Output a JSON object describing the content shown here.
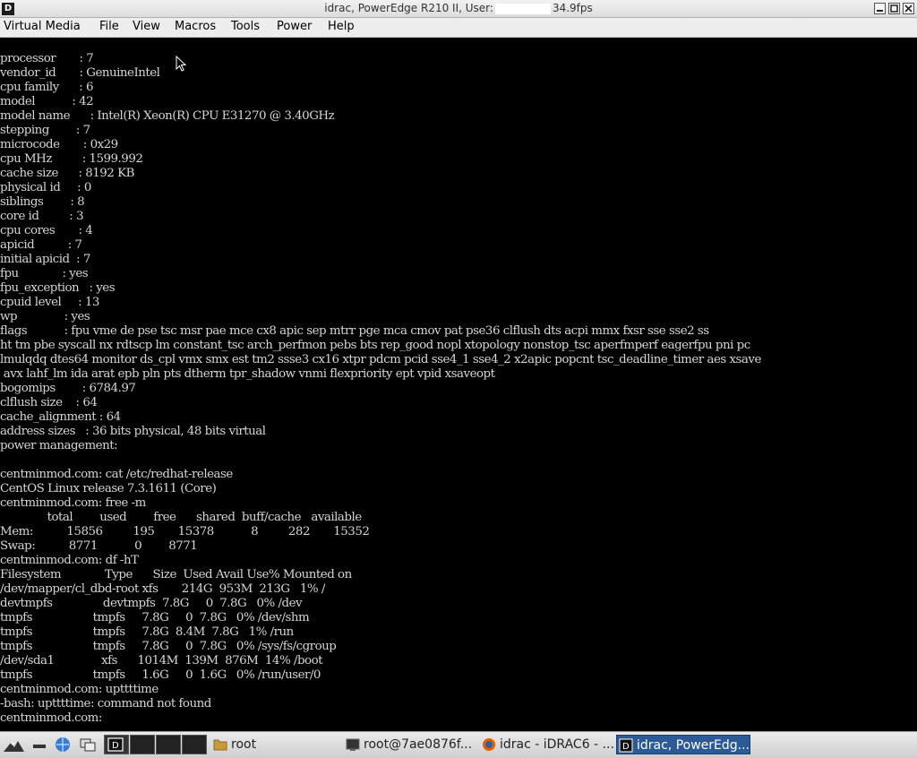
{
  "window": {
    "title_left": "idrac, PowerEdge R210 II, User:",
    "title_right": "34.9fps"
  },
  "menu": {
    "items": [
      "Virtual Media",
      "File",
      "View",
      "Macros",
      "Tools",
      "Power",
      "Help"
    ]
  },
  "console": {
    "lines": [
      "processor       : 7",
      "vendor_id       : GenuineIntel",
      "cpu family      : 6",
      "model           : 42",
      "model name      : Intel(R) Xeon(R) CPU E31270 @ 3.40GHz",
      "stepping        : 7",
      "microcode       : 0x29",
      "cpu MHz         : 1599.992",
      "cache size      : 8192 KB",
      "physical id     : 0",
      "siblings        : 8",
      "core id         : 3",
      "cpu cores       : 4",
      "apicid          : 7",
      "initial apicid  : 7",
      "fpu             : yes",
      "fpu_exception   : yes",
      "cpuid level     : 13",
      "wp              : yes",
      "flags           : fpu vme de pse tsc msr pae mce cx8 apic sep mtrr pge mca cmov pat pse36 clflush dts acpi mmx fxsr sse sse2 ss",
      "ht tm pbe syscall nx rdtscp lm constant_tsc arch_perfmon pebs bts rep_good nopl xtopology nonstop_tsc aperfmperf eagerfpu pni pc",
      "lmulqdq dtes64 monitor ds_cpl vmx smx est tm2 ssse3 cx16 xtpr pdcm pcid sse4_1 sse4_2 x2apic popcnt tsc_deadline_timer aes xsave",
      " avx lahf_lm ida arat epb pln pts dtherm tpr_shadow vnmi flexpriority ept vpid xsaveopt",
      "bogomips        : 6784.97",
      "clflush size    : 64",
      "cache_alignment : 64",
      "address sizes   : 36 bits physical, 48 bits virtual",
      "power management:",
      "",
      "centminmod.com: cat /etc/redhat-release",
      "CentOS Linux release 7.3.1611 (Core)",
      "centminmod.com: free -m",
      "              total        used        free      shared  buff/cache   available",
      "Mem:          15856         195       15378           8         282       15352",
      "Swap:          8771           0        8771",
      "centminmod.com: df -hT",
      "Filesystem             Type      Size  Used Avail Use% Mounted on",
      "/dev/mapper/cl_dbd-root xfs       214G  953M  213G   1% /",
      "devtmpfs               devtmpfs  7.8G     0  7.8G   0% /dev",
      "tmpfs                  tmpfs     7.8G     0  7.8G   0% /dev/shm",
      "tmpfs                  tmpfs     7.8G  8.4M  7.8G   1% /run",
      "tmpfs                  tmpfs     7.8G     0  7.8G   0% /sys/fs/cgroup",
      "/dev/sda1              xfs      1014M  139M  876M  14% /boot",
      "tmpfs                  tmpfs     1.6G     0  1.6G   0% /run/user/0",
      "centminmod.com: upttttime",
      "-bash: upttttime: command not found",
      "centminmod.com: "
    ]
  },
  "taskbar": {
    "tasks": [
      {
        "label": "root",
        "icon": "folder-icon"
      },
      {
        "label": "root@7ae0876f...",
        "icon": "terminal-icon"
      },
      {
        "label": "idrac - iDRAC6 - ...",
        "icon": "firefox-icon"
      },
      {
        "label": "idrac, PowerEdg...",
        "icon": "idrac-icon",
        "active": true
      }
    ]
  }
}
